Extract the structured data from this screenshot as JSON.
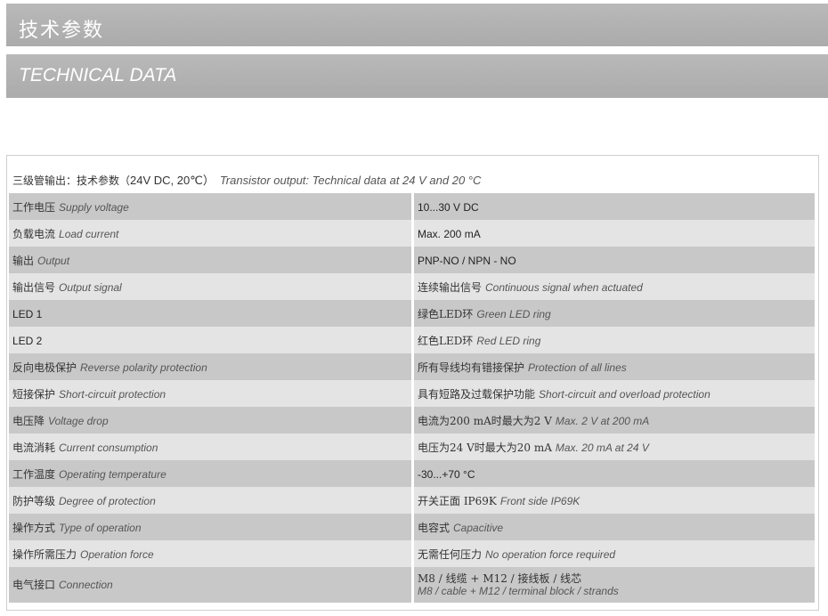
{
  "header": {
    "title_cn": "技术参数",
    "title_en": "TECHNICAL DATA"
  },
  "table": {
    "caption_cn": "三级管输出：技术参数（",
    "caption_mid": "24V DC, 20℃）",
    "caption_en": "Transistor output: Technical data at 24 V and 20 °C",
    "rows": [
      {
        "label_cn": "工作电压",
        "label_en": "Supply voltage",
        "value": "10...30 V DC",
        "value_en": ""
      },
      {
        "label_cn": "负载电流",
        "label_en": "Load current",
        "value": "Max. 200 mA",
        "value_en": ""
      },
      {
        "label_cn": "输出",
        "label_en": "Output",
        "value": "PNP-NO / NPN - NO",
        "value_en": ""
      },
      {
        "label_cn": "输出信号",
        "label_en": "Output signal",
        "value": "连续输出信号",
        "value_en": "Continuous signal when actuated"
      },
      {
        "label_cn": "LED 1",
        "label_en": "",
        "value": "绿色LED环",
        "value_en": "Green LED ring"
      },
      {
        "label_cn": "LED 2",
        "label_en": "",
        "value": "红色LED环",
        "value_en": "Red LED ring"
      },
      {
        "label_cn": "反向电极保护",
        "label_en": "Reverse polarity protection",
        "value": "所有导线均有错接保护",
        "value_en": "Protection of all lines"
      },
      {
        "label_cn": "短接保护",
        "label_en": "Short-circuit protection",
        "value": "具有短路及过载保护功能",
        "value_en": "Short-circuit and overload protection"
      },
      {
        "label_cn": "电压降",
        "label_en": "Voltage drop",
        "value": "电流为200 mA时最大为2 V",
        "value_en": "Max. 2 V at 200 mA"
      },
      {
        "label_cn": "电流消耗",
        "label_en": "Current consumption",
        "value": "电压为24 V时最大为20 mA",
        "value_en": "Max. 20 mA at 24 V"
      },
      {
        "label_cn": "工作温度",
        "label_en": "Operating temperature",
        "value": "-30...+70 °C",
        "value_en": ""
      },
      {
        "label_cn": "防护等级",
        "label_en": "Degree of protection",
        "value": "开关正面 IP69K",
        "value_en": "Front side IP69K"
      },
      {
        "label_cn": "操作方式",
        "label_en": "Type of operation",
        "value": "电容式",
        "value_en": "Capacitive"
      },
      {
        "label_cn": "操作所需压力",
        "label_en": "Operation force",
        "value": "无需任何压力",
        "value_en": "No operation force required"
      },
      {
        "label_cn": "电气接口",
        "label_en": "Connection",
        "value": "M8 / 线缆 + M12 / 接线板 / 线芯",
        "value_en": "M8 / cable + M12 / terminal block / strands"
      }
    ]
  },
  "colors": {
    "band": "#b0b0b0",
    "row_dark": "#c8c8c8",
    "row_light": "#e4e4e4"
  }
}
